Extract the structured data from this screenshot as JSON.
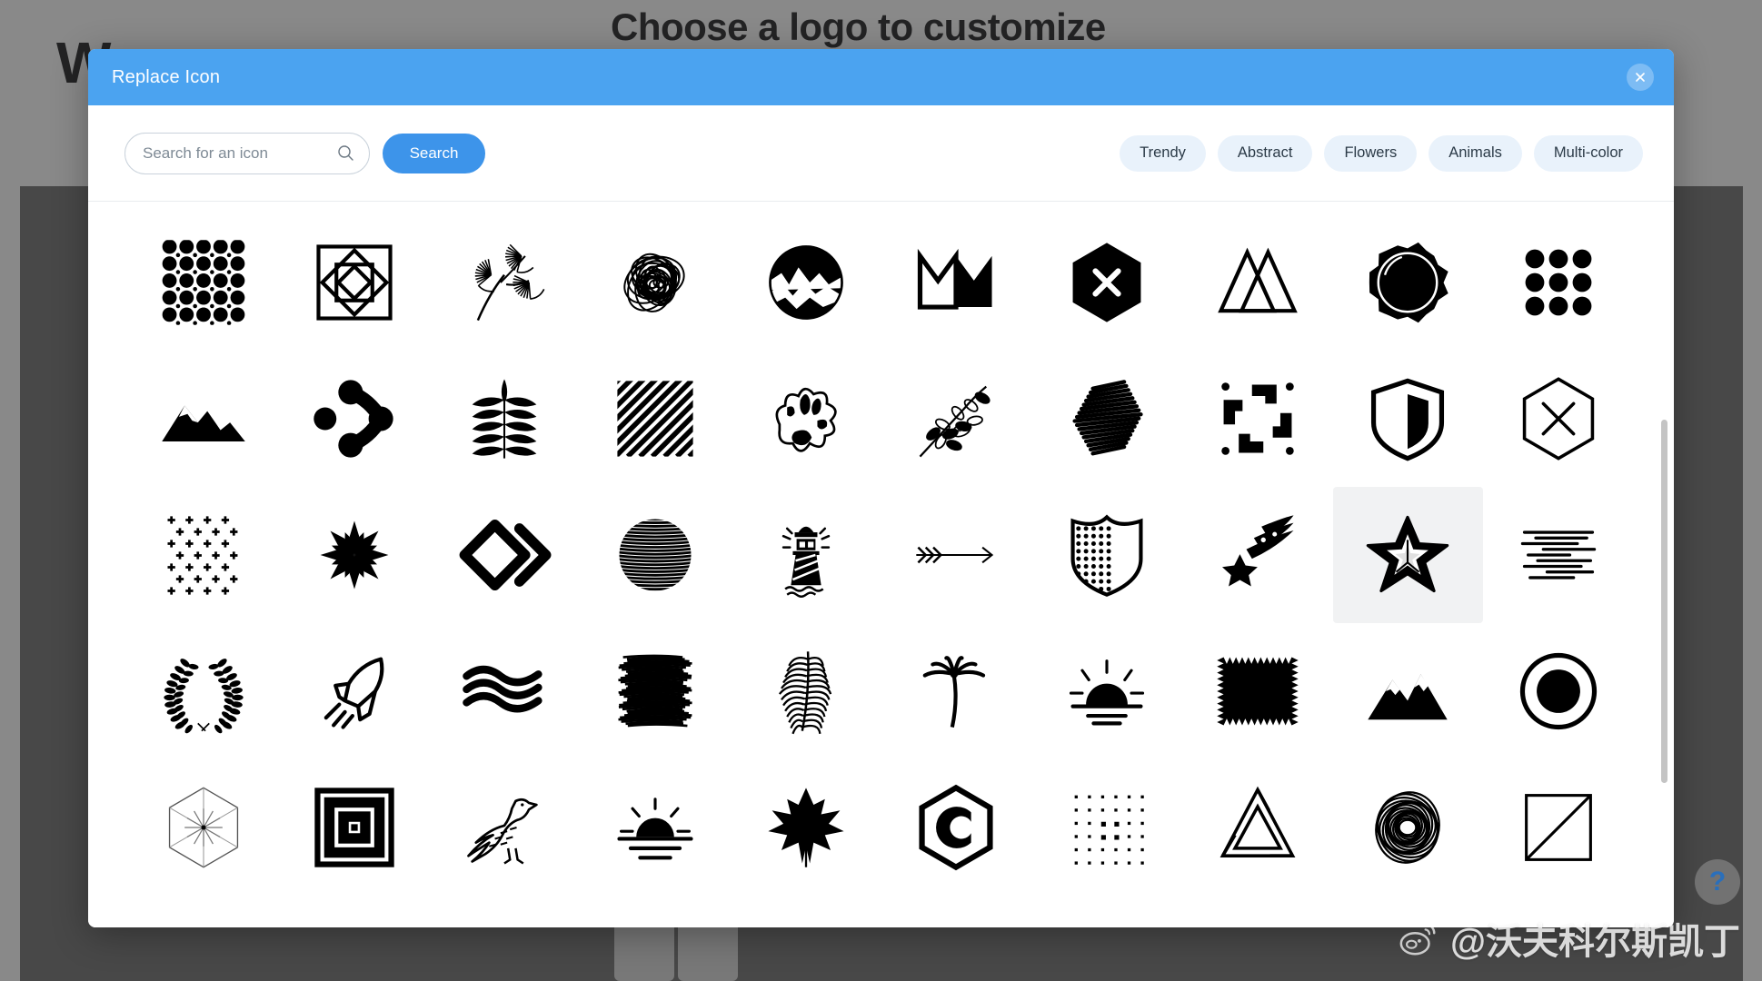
{
  "background": {
    "heading": "Choose a logo to customize",
    "wordmark": "W"
  },
  "modal": {
    "title": "Replace Icon",
    "close_icon": "close-icon"
  },
  "toolbar": {
    "search": {
      "placeholder": "Search for an icon",
      "value": "",
      "icon": "search-icon"
    },
    "search_button_label": "Search",
    "categories": [
      {
        "label": "Trendy"
      },
      {
        "label": "Abstract"
      },
      {
        "label": "Flowers"
      },
      {
        "label": "Animals"
      },
      {
        "label": "Multi-color"
      }
    ]
  },
  "icons": [
    {
      "name": "dot-pattern-icon",
      "selected": false
    },
    {
      "name": "nested-squares-icon",
      "selected": false
    },
    {
      "name": "leaf-sprig-icon",
      "selected": false
    },
    {
      "name": "scribble-ball-icon",
      "selected": false
    },
    {
      "name": "circle-landscape-icon",
      "selected": false
    },
    {
      "name": "crown-icon",
      "selected": false
    },
    {
      "name": "hexagon-x-filled-icon",
      "selected": false
    },
    {
      "name": "twin-triangles-icon",
      "selected": false
    },
    {
      "name": "wax-seal-icon",
      "selected": false
    },
    {
      "name": "nine-dot-grid-icon",
      "selected": false
    },
    {
      "name": "mountain-range-icon",
      "selected": false
    },
    {
      "name": "molecule-node-icon",
      "selected": false
    },
    {
      "name": "fern-leaf-icon",
      "selected": false
    },
    {
      "name": "diagonal-stripes-icon",
      "selected": false
    },
    {
      "name": "abstract-blob-icon",
      "selected": false
    },
    {
      "name": "botanical-branch-icon",
      "selected": false
    },
    {
      "name": "hatch-scribble-icon",
      "selected": false
    },
    {
      "name": "pinwheel-arrows-icon",
      "selected": false
    },
    {
      "name": "shield-half-icon",
      "selected": false
    },
    {
      "name": "hexagon-x-outline-icon",
      "selected": false
    },
    {
      "name": "plus-grid-icon",
      "selected": false
    },
    {
      "name": "starburst-flower-icon",
      "selected": false
    },
    {
      "name": "diamond-chevron-icon",
      "selected": false
    },
    {
      "name": "striped-sphere-icon",
      "selected": false
    },
    {
      "name": "lighthouse-icon",
      "selected": false
    },
    {
      "name": "fletched-arrow-icon",
      "selected": false
    },
    {
      "name": "dotted-shield-icon",
      "selected": false
    },
    {
      "name": "shooting-star-icon",
      "selected": false
    },
    {
      "name": "hand-drawn-star-icon",
      "selected": true
    },
    {
      "name": "motion-lines-icon",
      "selected": false
    },
    {
      "name": "laurel-wreath-icon",
      "selected": false
    },
    {
      "name": "rocket-icon",
      "selected": false
    },
    {
      "name": "waves-icon",
      "selected": false
    },
    {
      "name": "ink-scribble-icon",
      "selected": false
    },
    {
      "name": "palm-frond-icon",
      "selected": false
    },
    {
      "name": "palm-tree-icon",
      "selected": false
    },
    {
      "name": "sunrise-rays-icon",
      "selected": false
    },
    {
      "name": "zigzag-square-icon",
      "selected": false
    },
    {
      "name": "snow-mountains-icon",
      "selected": false
    },
    {
      "name": "circle-crescent-icon",
      "selected": false
    },
    {
      "name": "hexagon-radial-icon",
      "selected": false
    },
    {
      "name": "concentric-squares-icon",
      "selected": false
    },
    {
      "name": "eagle-icon",
      "selected": false
    },
    {
      "name": "sunset-icon",
      "selected": false
    },
    {
      "name": "maple-leaf-icon",
      "selected": false
    },
    {
      "name": "hexagon-c-icon",
      "selected": false
    },
    {
      "name": "dot-matrix-icon",
      "selected": false
    },
    {
      "name": "penrose-triangle-icon",
      "selected": false
    },
    {
      "name": "scribble-circle-icon",
      "selected": false
    },
    {
      "name": "split-square-icon",
      "selected": false
    }
  ],
  "watermark": {
    "handle": "@沃夫科尔斯凯丁",
    "logo": "weibo-icon"
  },
  "help": {
    "label": "?"
  },
  "colors": {
    "header_blue": "#4ba3f0",
    "button_blue": "#3d94ea",
    "pill_blue": "#e9f2fb",
    "selected_cell": "#f1f2f3",
    "overlay": "rgba(40,40,40,0.55)"
  }
}
